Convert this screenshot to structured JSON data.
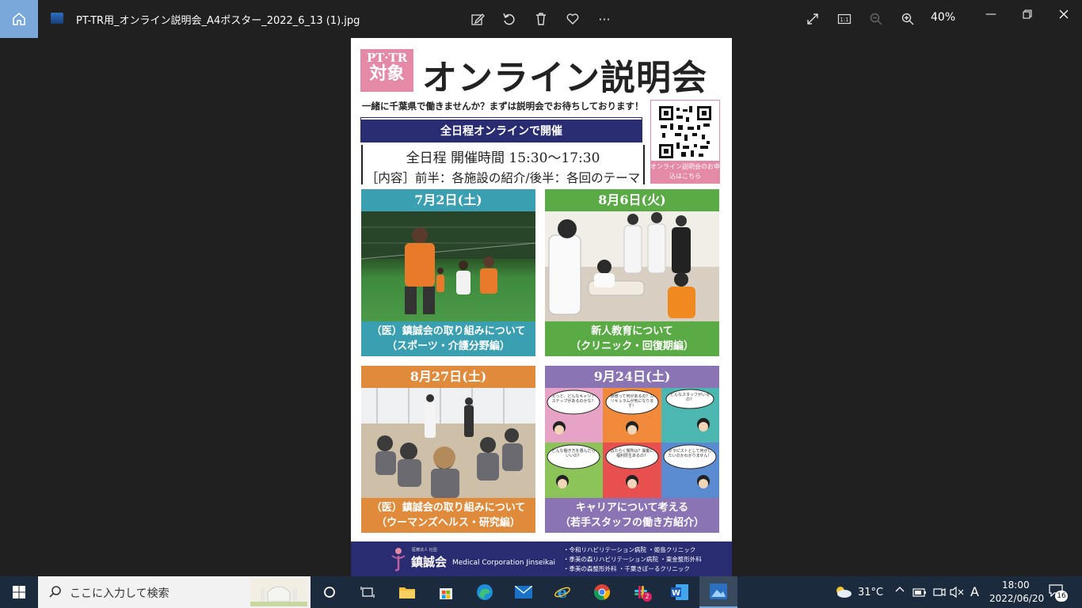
{
  "titlebar": {
    "file_name": "PT-TR用_オンライン説明会_A4ポスター_2022_6_13 (1).jpg",
    "zoom": "40%"
  },
  "poster": {
    "badge_line1": "PT·TR",
    "badge_line2": "対象",
    "title": "オンライン説明会",
    "tagline": "一緒に千葉県で働きませんか？まずは説明会でお待ちしております！",
    "banner": "全日程オンラインで開催",
    "schedule_line1": "全日程 開催時間 15:30〜17:30",
    "schedule_line2": "［内容］前半：各施設の紹介/後半：各回のテーマ",
    "qr_label": "オンライン説明会のお申込はこちら",
    "cards": [
      {
        "date": "7月2日(土)",
        "caption1": "（医）鎮誠会の取り組みについて",
        "caption2": "（スポーツ・介護分野編）"
      },
      {
        "date": "8月6日(火)",
        "caption1": "新人教育について",
        "caption2": "（クリニック・回復期編）"
      },
      {
        "date": "8月27日(土)",
        "caption1": "（医）鎮誠会の取り組みについて",
        "caption2": "（ウーマンズヘルス・研究編）"
      },
      {
        "date": "9月24日(土)",
        "caption1": "キャリアについて考える",
        "caption2": "（若手スタッフの働き方紹介）"
      }
    ],
    "bubbles": [
      "えっと、どんなキャリアステップがあるのかな？",
      "研修って何があるの？カリキュラムが気になります！",
      "どんなスタッフがいるの？",
      "どんな働き方を選んだらいいの？",
      "はたらく場所は？異動に福利厚生あるの？",
      "セラピストとして何がしたいのかわかりません！"
    ],
    "footer": {
      "small": "医療法人 社団",
      "name": "鎮誠会",
      "english": "Medical Corporation Jinseikai",
      "facilities": [
        "・令和リハビリテーション病院 ・姫島クリニック",
        "・季美の森リハビリテーション病院 ・東金整形外科",
        "・季美の森整形外科 ・千葉きぼーるクリニック"
      ]
    }
  },
  "taskbar": {
    "search_placeholder": "ここに入力して検索",
    "weather": "31°C",
    "time": "18:00",
    "date": "2022/06/20",
    "ime": "A",
    "notifications": "16",
    "slack_badge": "2"
  }
}
